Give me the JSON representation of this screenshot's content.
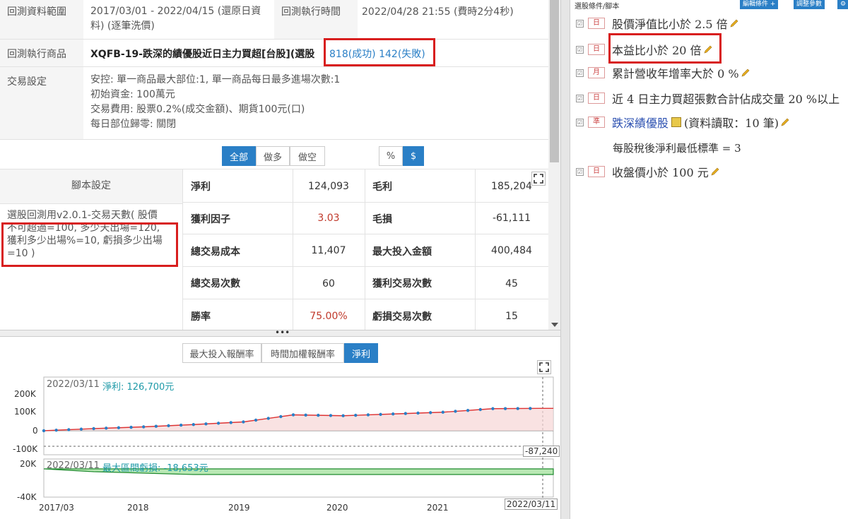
{
  "info": {
    "range_label": "回測資料範圍",
    "range_value_line1": "2017/03/01 - 2022/04/15 (還原日資",
    "range_value_line2": "料) (逐筆洗價)",
    "time_label": "回測執行時間",
    "time_value": "2022/04/28 21:55 (費時2分4秒)",
    "product_label": "回測執行商品",
    "product_value": "XQFB-19-跌深的績優股近日主力買超[台股](選股",
    "success": "818(成功)",
    "fail": "142(失敗)",
    "trade_label": "交易設定",
    "trade_line1": "安控: 單一商品最大部位:1, 單一商品每日最多進場次數:1",
    "trade_line2": "初始資金: 100萬元",
    "trade_line3": "交易費用: 股票0.2%(成交金額)、期貨100元(口)",
    "trade_line4": "每日部位歸零: 關閉"
  },
  "filters": {
    "all": "全部",
    "long": "做多",
    "short": "做空",
    "percent": "%",
    "dollar": "$"
  },
  "script": {
    "header": "腳本設定",
    "line1": "選股回測用v2.0.1-交易天數( 股價",
    "line2": "不可超過=100, 多少天出場=120,",
    "line3": "獲利多少出場%=10, 虧損多少出場",
    "line4": "=10 )"
  },
  "stats": [
    {
      "l1": "淨利",
      "v1": "124,093",
      "l2": "毛利",
      "v2": "185,204"
    },
    {
      "l1": "獲利因子",
      "v1": "3.03",
      "l2": "毛損",
      "v2": "-61,111"
    },
    {
      "l1": "總交易成本",
      "v1": "11,407",
      "l2": "最大投入金額",
      "v2": "400,484"
    },
    {
      "l1": "總交易次數",
      "v1": "60",
      "l2": "獲利交易次數",
      "v2": "45"
    },
    {
      "l1": "勝率",
      "v1": "75.00%",
      "l2": "虧損交易次數",
      "v2": "15"
    }
  ],
  "chart_tabs": {
    "t1": "最大投入報酬率",
    "t2": "時間加權報酬率",
    "t3": "淨利"
  },
  "chart_data": [
    {
      "type": "line",
      "title": "",
      "date_label": "2022/03/11",
      "series_label": "淨利: 126,700元",
      "y_ticks": [
        "200K",
        "100K",
        "0",
        "-100K"
      ],
      "ylim": [
        -100000,
        200000
      ],
      "marker_value": "-87,240",
      "x": [
        "2017/03",
        "2017/09",
        "2018/03",
        "2018/09",
        "2019/03",
        "2019/09",
        "2020/03",
        "2020/09",
        "2021/03",
        "2021/09",
        "2022/03"
      ],
      "series": [
        {
          "name": "淨利",
          "values": [
            0,
            12000,
            22000,
            35000,
            50000,
            90000,
            85000,
            95000,
            105000,
            125000,
            126700
          ]
        }
      ]
    },
    {
      "type": "area",
      "title": "",
      "date_label": "2022/03/11",
      "series_label": "最大區間虧損: -18,653元",
      "y_ticks": [
        "20K",
        "-40K"
      ],
      "ylim": [
        -40000,
        20000
      ],
      "x": [
        "2017/03",
        "2017/09",
        "2018/03",
        "2018/09",
        "2019/03",
        "2019/09",
        "2020/03",
        "2020/09",
        "2021/03",
        "2021/09",
        "2022/03"
      ],
      "series": [
        {
          "name": "最大區間虧損",
          "values": [
            0,
            -4000,
            -6000,
            -8000,
            -8000,
            -8000,
            -8000,
            -8000,
            -8000,
            -8000,
            -8000
          ]
        }
      ]
    }
  ],
  "x_ticks": [
    "2017/03",
    "2018",
    "2019",
    "2020",
    "2021",
    "2022/03/11"
  ],
  "right": {
    "header": "選股條件/腳本",
    "edit_btn": "編輯條件 +",
    "adjust_btn": "調整參數",
    "cond1": "股價淨值比小於 2.5 倍",
    "cond2": "本益比小於 20 倍",
    "cond3": "累計營收年增率大於 0 %",
    "cond4": "近 4 日主力買超張數合計佔成交量 20 %以上",
    "cond5_link": "跌深績優股",
    "cond5_rest": "(資料讀取：10 筆)",
    "cond5_sub": "每股稅後淨利最低標準 = 3",
    "cond6": "收盤價小於 100 元",
    "badge_day": "日",
    "badge_month": "月",
    "badge_script": "準"
  },
  "colors": {
    "accent": "#2a7fc6",
    "highlight_red": "#d81e1e",
    "value_red": "#c0392b",
    "teal": "#1e9aa8"
  }
}
